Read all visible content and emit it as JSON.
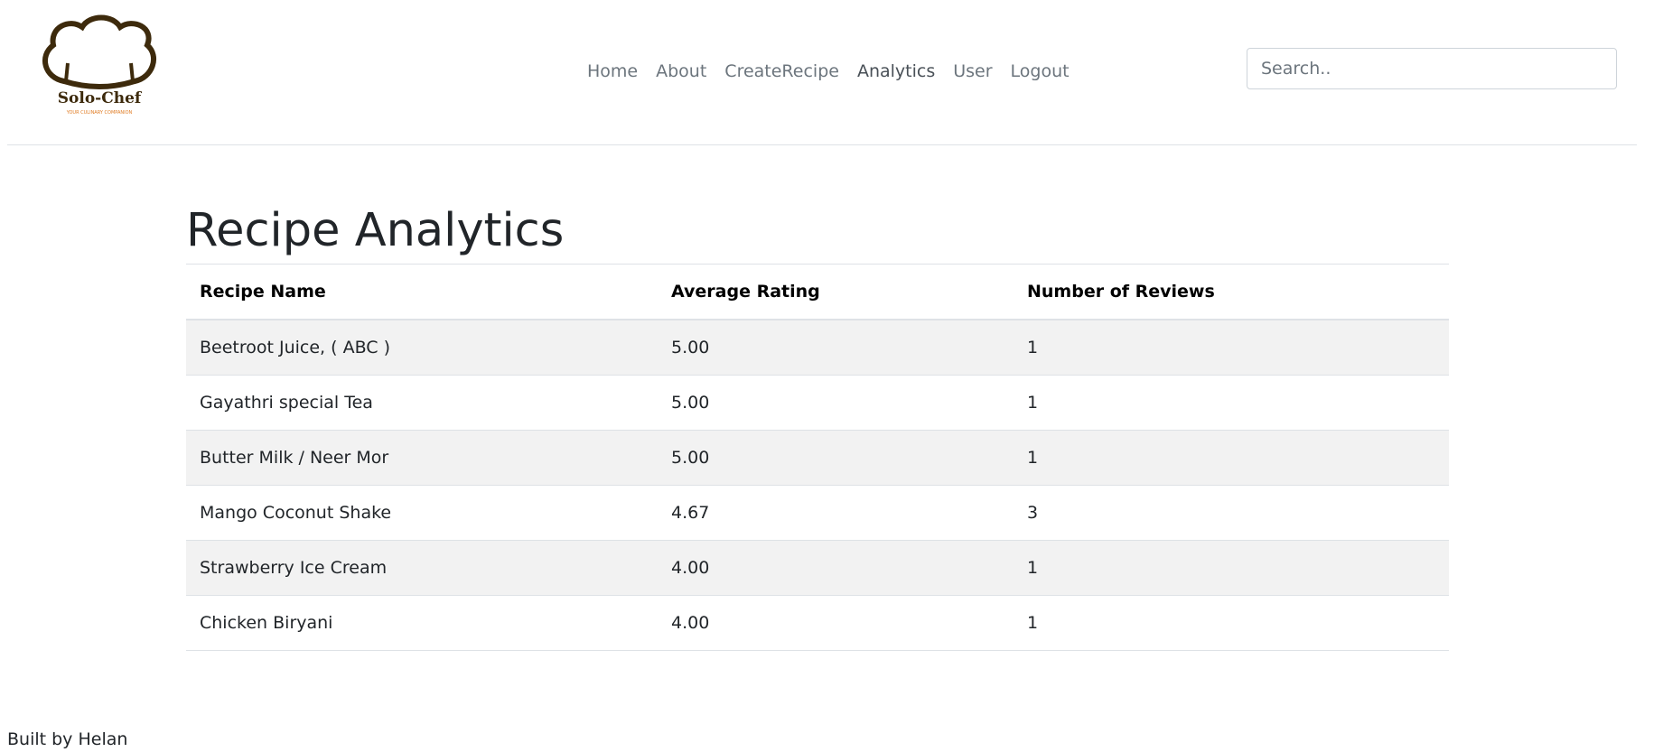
{
  "brand": {
    "name": "Solo-Chef",
    "tagline": "YOUR CULINARY COMPANION",
    "colors": {
      "hat": "#3d2a0c",
      "tagline": "#e07b22"
    }
  },
  "nav": {
    "items": [
      {
        "label": "Home"
      },
      {
        "label": "About"
      },
      {
        "label": "CreateRecipe"
      },
      {
        "label": "Analytics"
      },
      {
        "label": "User"
      },
      {
        "label": "Logout"
      }
    ]
  },
  "search": {
    "placeholder": "Search.."
  },
  "page": {
    "title": "Recipe Analytics"
  },
  "table": {
    "headers": [
      "Recipe Name",
      "Average Rating",
      "Number of Reviews"
    ],
    "rows": [
      [
        "Beetroot Juice, ( ABC )",
        "5.00",
        "1"
      ],
      [
        "Gayathri special Tea",
        "5.00",
        "1"
      ],
      [
        "Butter Milk / Neer Mor",
        "5.00",
        "1"
      ],
      [
        "Mango Coconut Shake",
        "4.67",
        "3"
      ],
      [
        "Strawberry Ice Cream",
        "4.00",
        "1"
      ],
      [
        "Chicken Biryani",
        "4.00",
        "1"
      ]
    ]
  },
  "footer": {
    "text": "Built by Helan"
  }
}
